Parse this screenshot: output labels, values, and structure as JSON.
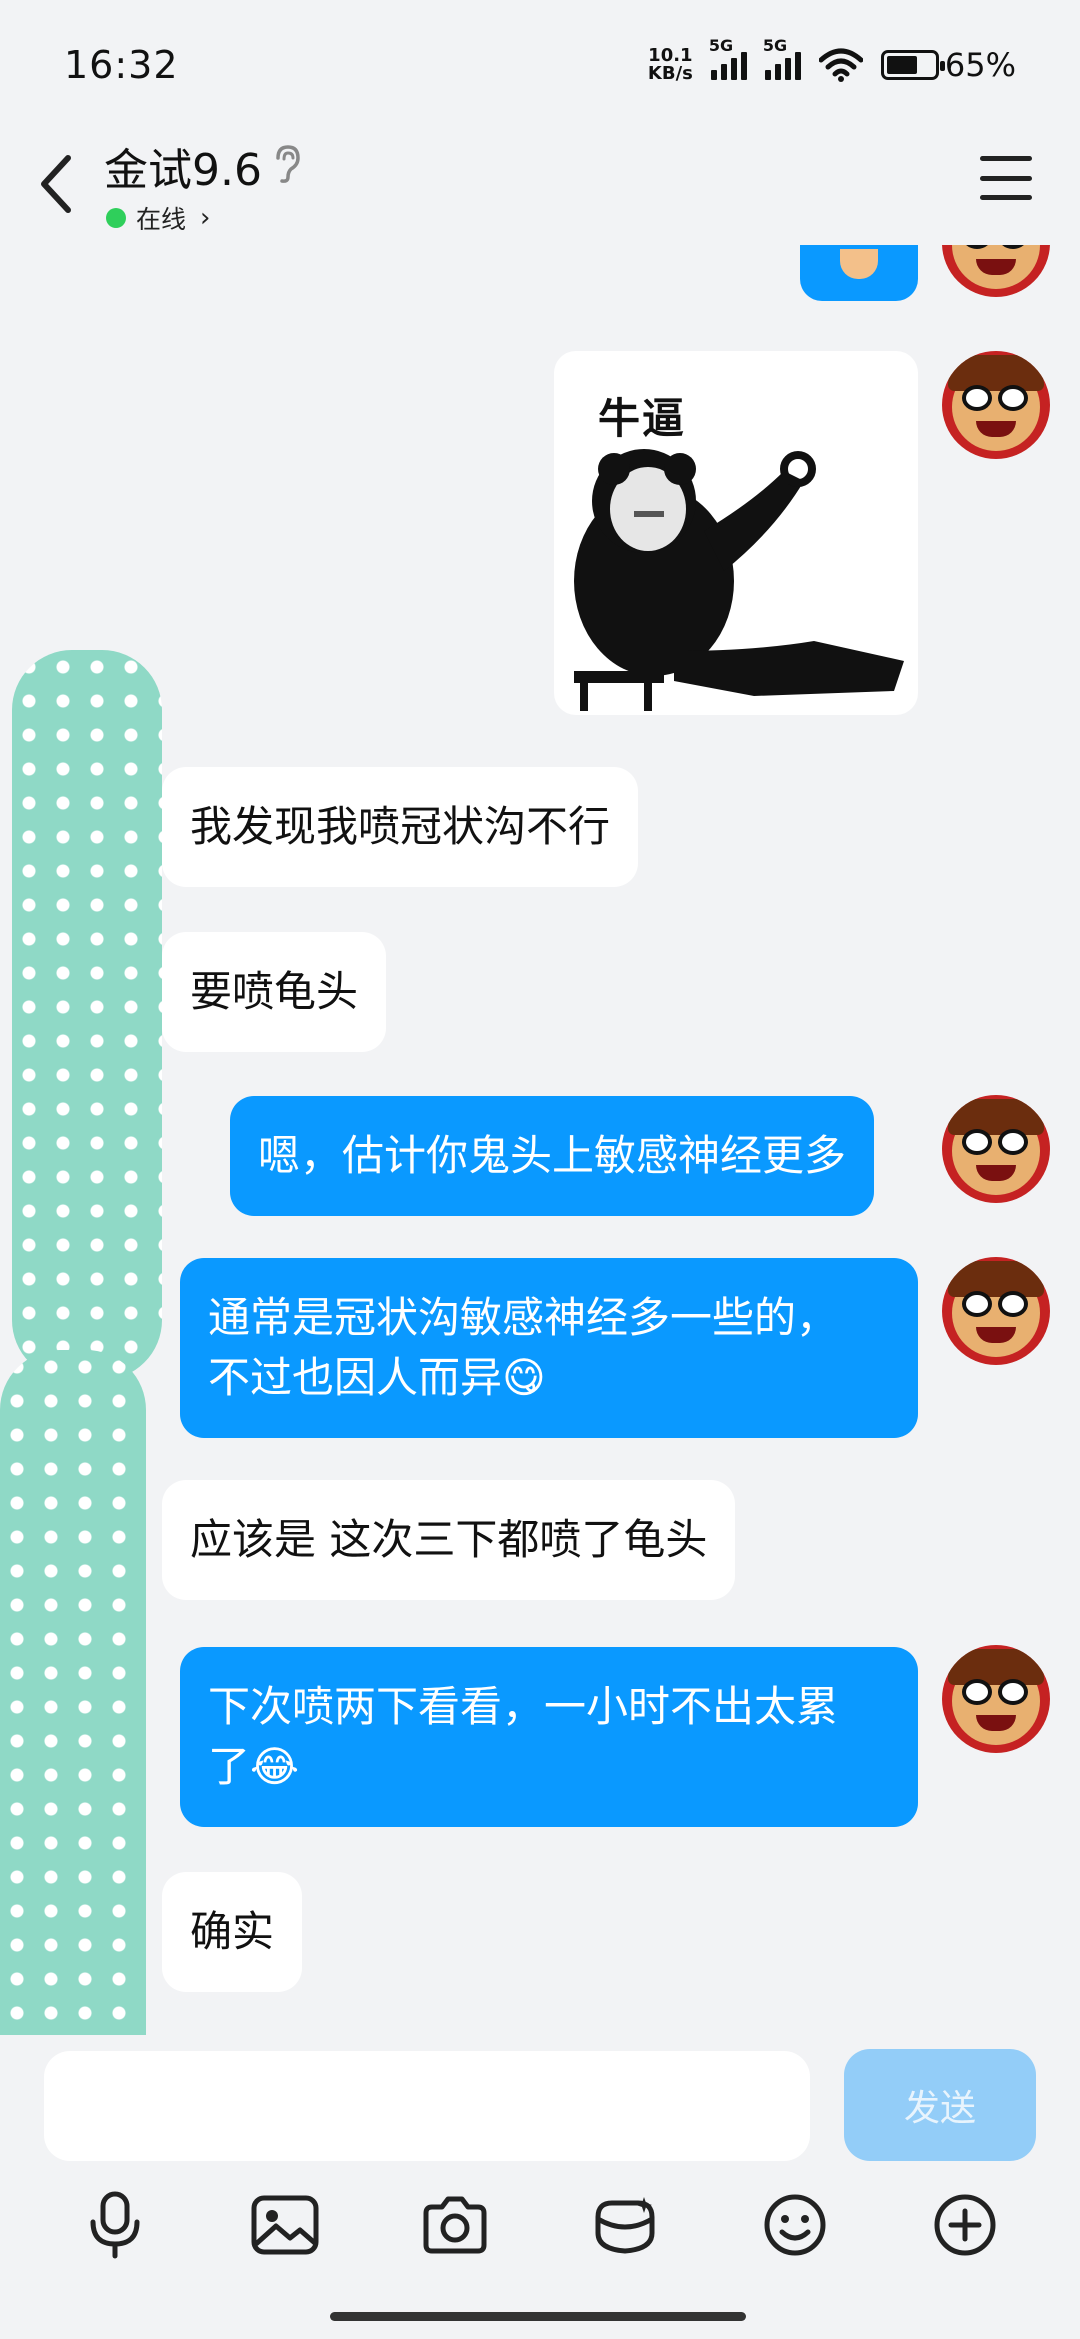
{
  "status_bar": {
    "time": "16:32",
    "net_speed_top": "10.1",
    "net_speed_bottom": "KB/s",
    "sim1": "5G",
    "sim2": "5G",
    "battery_percent": "65%",
    "battery_level": 0.65
  },
  "header": {
    "contact_name": "金试9.6",
    "status": "在线",
    "status_color": "#2fcf5b"
  },
  "messages": [
    {
      "side": "out",
      "type": "sticker",
      "text": "牛逼"
    },
    {
      "side": "in",
      "type": "text",
      "text": "我发现我喷冠状沟不行"
    },
    {
      "side": "in",
      "type": "text",
      "text": "要喷龟头"
    },
    {
      "side": "out",
      "type": "text",
      "text": "嗯，估计你鬼头上敏感神经更多"
    },
    {
      "side": "out",
      "type": "text",
      "text": "通常是冠状沟敏感神经多一些的，\n不过也因人而异😋"
    },
    {
      "side": "in",
      "type": "text",
      "text": "应该是 这次三下都喷了龟头"
    },
    {
      "side": "out",
      "type": "text",
      "text": "下次喷两下看看，一小时不出太累\n了😂"
    },
    {
      "side": "in",
      "type": "text",
      "text": "确实"
    }
  ],
  "input": {
    "placeholder": "",
    "send_label": "发送"
  },
  "toolbar": [
    "microphone-icon",
    "image-icon",
    "camera-icon",
    "red-packet-icon",
    "emoji-icon",
    "plus-icon"
  ],
  "colors": {
    "outgoing_bubble": "#0a99ff",
    "incoming_bubble": "#ffffff",
    "background": "#f2f3f5",
    "send_button": "#93cdf8"
  }
}
